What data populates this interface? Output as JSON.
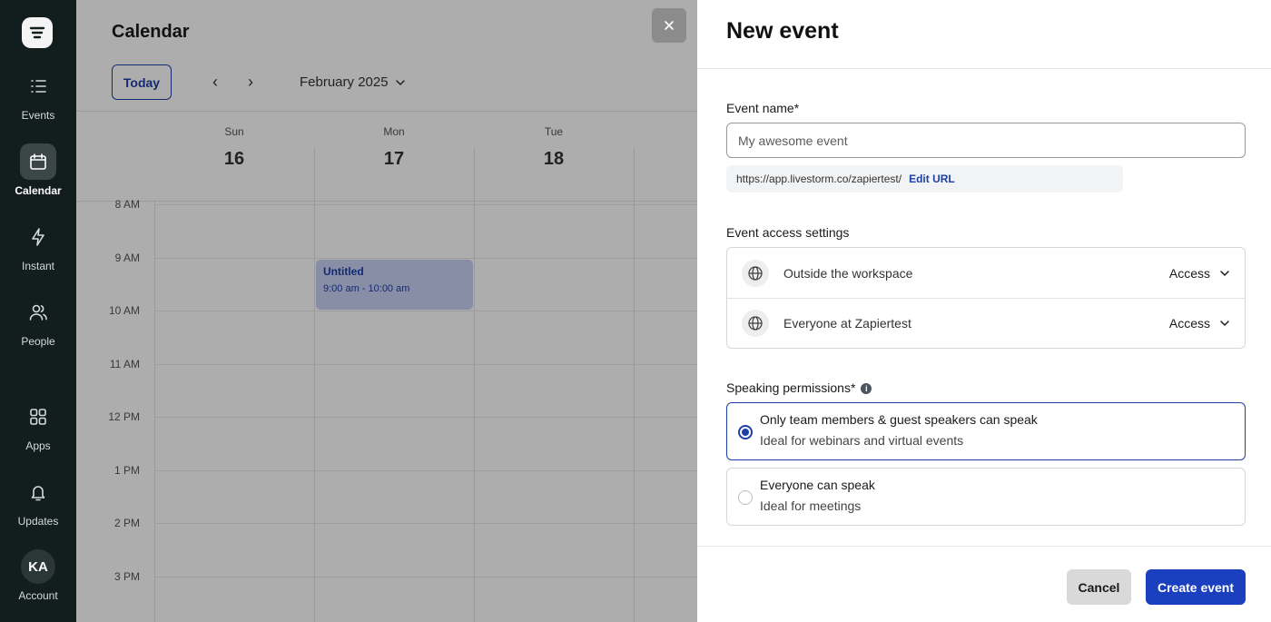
{
  "sidebar": {
    "items": [
      {
        "label": "Events",
        "icon": "list-icon"
      },
      {
        "label": "Calendar",
        "icon": "calendar-icon",
        "active": true
      },
      {
        "label": "Instant",
        "icon": "lightning-icon"
      },
      {
        "label": "People",
        "icon": "people-icon"
      },
      {
        "label": "Apps",
        "icon": "apps-grid-icon"
      },
      {
        "label": "Updates",
        "icon": "bell-icon"
      }
    ],
    "account": {
      "initials": "KA",
      "label": "Account"
    }
  },
  "calendar": {
    "title": "Calendar",
    "today_label": "Today",
    "month": "February 2025",
    "days": [
      {
        "name": "Sun",
        "num": "16"
      },
      {
        "name": "Mon",
        "num": "17"
      },
      {
        "name": "Tue",
        "num": "18"
      }
    ],
    "times": [
      "8 AM",
      "9 AM",
      "10 AM",
      "11 AM",
      "12 PM",
      "1 PM",
      "2 PM",
      "3 PM"
    ],
    "event": {
      "title": "Untitled",
      "time": "9:00 am - 10:00 am"
    }
  },
  "drawer": {
    "title": "New event",
    "event_name_label": "Event name*",
    "event_name_placeholder": "My awesome event",
    "url": "https://app.livestorm.co/zapiertest/",
    "edit_url_label": "Edit URL",
    "access_label": "Event access settings",
    "access_rows": [
      {
        "label": "Outside the workspace",
        "value": "Access"
      },
      {
        "label": "Everyone at Zapiertest",
        "value": "Access"
      }
    ],
    "speaking_label": "Speaking permissions*",
    "options": [
      {
        "title": "Only team members & guest speakers can speak",
        "subtitle": "Ideal for webinars and virtual events",
        "selected": true
      },
      {
        "title": "Everyone can speak",
        "subtitle": "Ideal for meetings",
        "selected": false
      }
    ],
    "cancel_label": "Cancel",
    "create_label": "Create event"
  },
  "colors": {
    "accent": "#1d3fa8",
    "sidebar_bg": "#121d1d",
    "primary_button": "#1a3fbf"
  }
}
